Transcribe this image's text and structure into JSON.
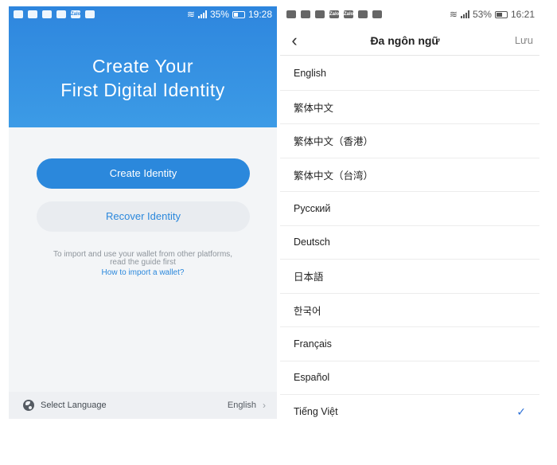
{
  "left_screen": {
    "status": {
      "battery": "35%",
      "time": "19:28"
    },
    "hero": {
      "title_line1": "Create Your",
      "title_line2": "First Digital Identity"
    },
    "create_button": "Create Identity",
    "recover_button": "Recover Identity",
    "note_line1": "To import and use your wallet from other platforms,",
    "note_line2": "read the guide first",
    "import_link": "How to import a wallet?",
    "language_bar": {
      "label": "Select Language",
      "value": "English",
      "chevron": "›"
    }
  },
  "right_screen": {
    "status": {
      "battery": "53%",
      "time": "16:21"
    },
    "header": {
      "back_glyph": "‹",
      "title": "Đa ngôn ngữ",
      "save": "Lưu"
    },
    "languages": [
      {
        "label": "English",
        "selected": false
      },
      {
        "label": "繁体中文",
        "selected": false
      },
      {
        "label": "繁体中文（香港）",
        "selected": false
      },
      {
        "label": "繁体中文（台湾）",
        "selected": false
      },
      {
        "label": "Русский",
        "selected": false
      },
      {
        "label": "Deutsch",
        "selected": false
      },
      {
        "label": "日本語",
        "selected": false
      },
      {
        "label": "한국어",
        "selected": false
      },
      {
        "label": "Français",
        "selected": false
      },
      {
        "label": "Español",
        "selected": false
      },
      {
        "label": "Tiếng Việt",
        "selected": true
      }
    ],
    "check_glyph": "✓"
  },
  "colors": {
    "primary": "#2b88dc",
    "hero_gradient_top": "#2e86de",
    "check": "#2b6fd6"
  },
  "icons": [
    "globe-icon",
    "chevron-right-icon",
    "back-arrow-icon",
    "checkmark-icon",
    "wifi-icon",
    "signal-icon",
    "battery-icon"
  ]
}
